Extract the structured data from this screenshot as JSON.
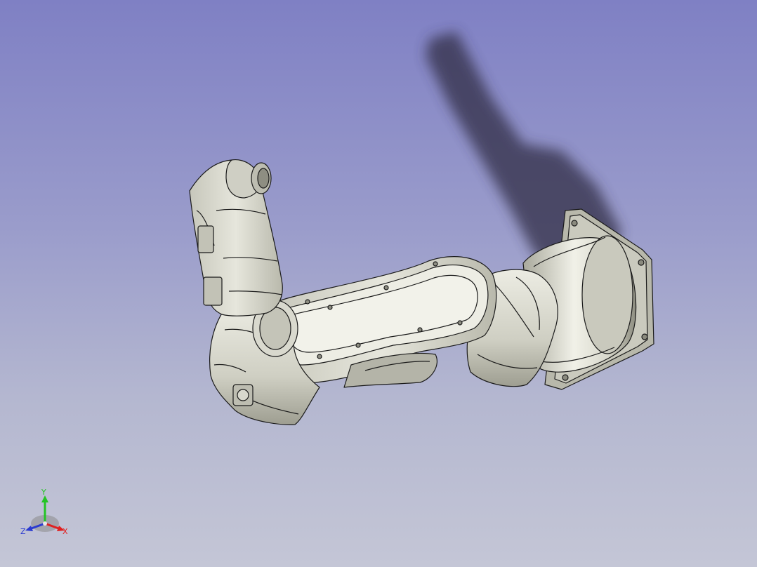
{
  "viewer": {
    "background_top": "#7f80c4",
    "background_bottom": "#c4c6d6",
    "model_color": "#d6d6cb",
    "edge_color": "#1a1a1a"
  },
  "axis_triad": {
    "x_label": "X",
    "y_label": "Y",
    "z_label": "Z",
    "x_color": "#e02020",
    "y_color": "#24c424",
    "z_color": "#2a3ad0"
  }
}
